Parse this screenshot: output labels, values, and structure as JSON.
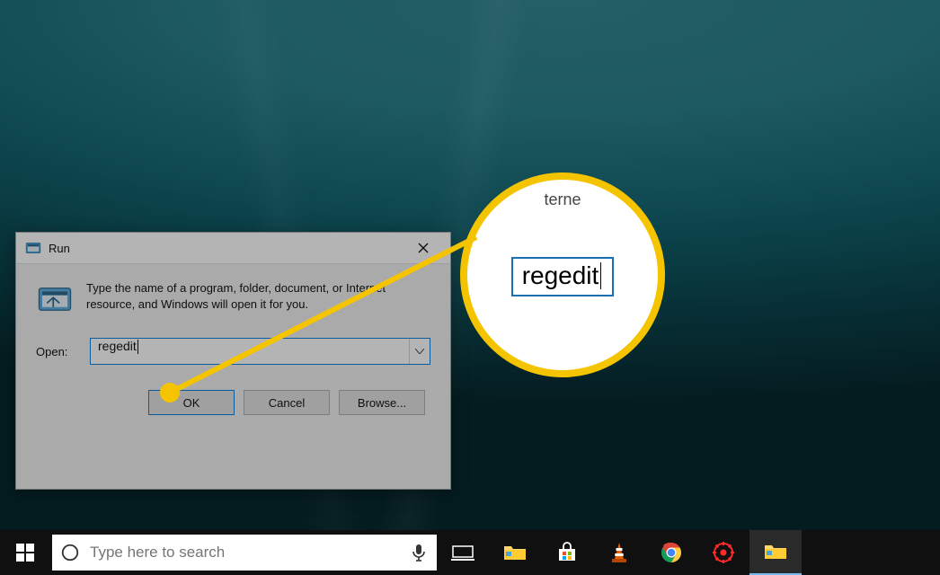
{
  "run_dialog": {
    "title": "Run",
    "hint": "Type the name of a program, folder, document, or Internet resource, and Windows will open it for you.",
    "open_label": "Open:",
    "input_value": "regedit",
    "ok": "OK",
    "cancel": "Cancel",
    "browse": "Browse..."
  },
  "callout": {
    "fragment": "terne",
    "value": "regedit"
  },
  "taskbar": {
    "search_placeholder": "Type here to search",
    "icons": [
      "task-view",
      "file-explorer",
      "microsoft-store",
      "vlc",
      "chrome",
      "radeon",
      "file-explorer-active"
    ]
  },
  "colors": {
    "accent": "#0078d7",
    "highlight": "#f5c400"
  }
}
